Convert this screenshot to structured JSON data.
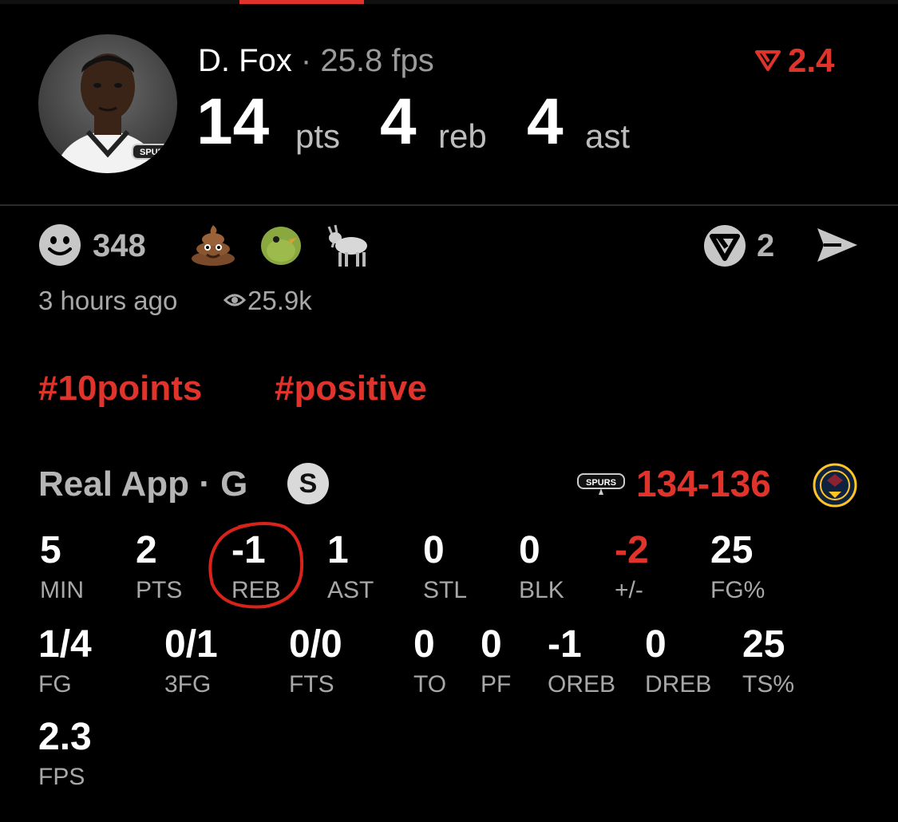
{
  "player": {
    "name": "D. Fox",
    "sep": "·",
    "fps": "25.8 fps",
    "pts": "14",
    "pts_unit": "pts",
    "reb": "4",
    "reb_unit": "reb",
    "ast": "4",
    "ast_unit": "ast",
    "vote_value": "2.4"
  },
  "reactions": {
    "count": "348",
    "icons": [
      "smiley-icon",
      "poop-icon",
      "bird-icon",
      "goat-icon"
    ],
    "comments": "2"
  },
  "meta": {
    "time": "3 hours ago",
    "views": "25.9k"
  },
  "tags": [
    "#10points",
    "#positive"
  ],
  "game": {
    "source": "Real App · G",
    "badge": "S",
    "score": "134-136"
  },
  "stats_row1": [
    {
      "value": "5",
      "label": "MIN"
    },
    {
      "value": "2",
      "label": "PTS"
    },
    {
      "value": "-1",
      "label": "REB"
    },
    {
      "value": "1",
      "label": "AST"
    },
    {
      "value": "0",
      "label": "STL"
    },
    {
      "value": "0",
      "label": "BLK"
    },
    {
      "value": "-2",
      "label": "+/-"
    },
    {
      "value": "25",
      "label": "FG%"
    }
  ],
  "stats_row2": [
    {
      "value": "1/4",
      "label": "FG"
    },
    {
      "value": "0/1",
      "label": "3FG"
    },
    {
      "value": "0/0",
      "label": "FTS"
    },
    {
      "value": "0",
      "label": "TO"
    },
    {
      "value": "0",
      "label": "PF"
    },
    {
      "value": "-1",
      "label": "OREB"
    },
    {
      "value": "0",
      "label": "DREB"
    },
    {
      "value": "25",
      "label": "TS%"
    }
  ],
  "stats_row3": [
    {
      "value": "2.3",
      "label": "FPS"
    }
  ],
  "colors": {
    "accent": "#e0332b",
    "muted": "#a8a8a8",
    "bg": "#000000"
  }
}
